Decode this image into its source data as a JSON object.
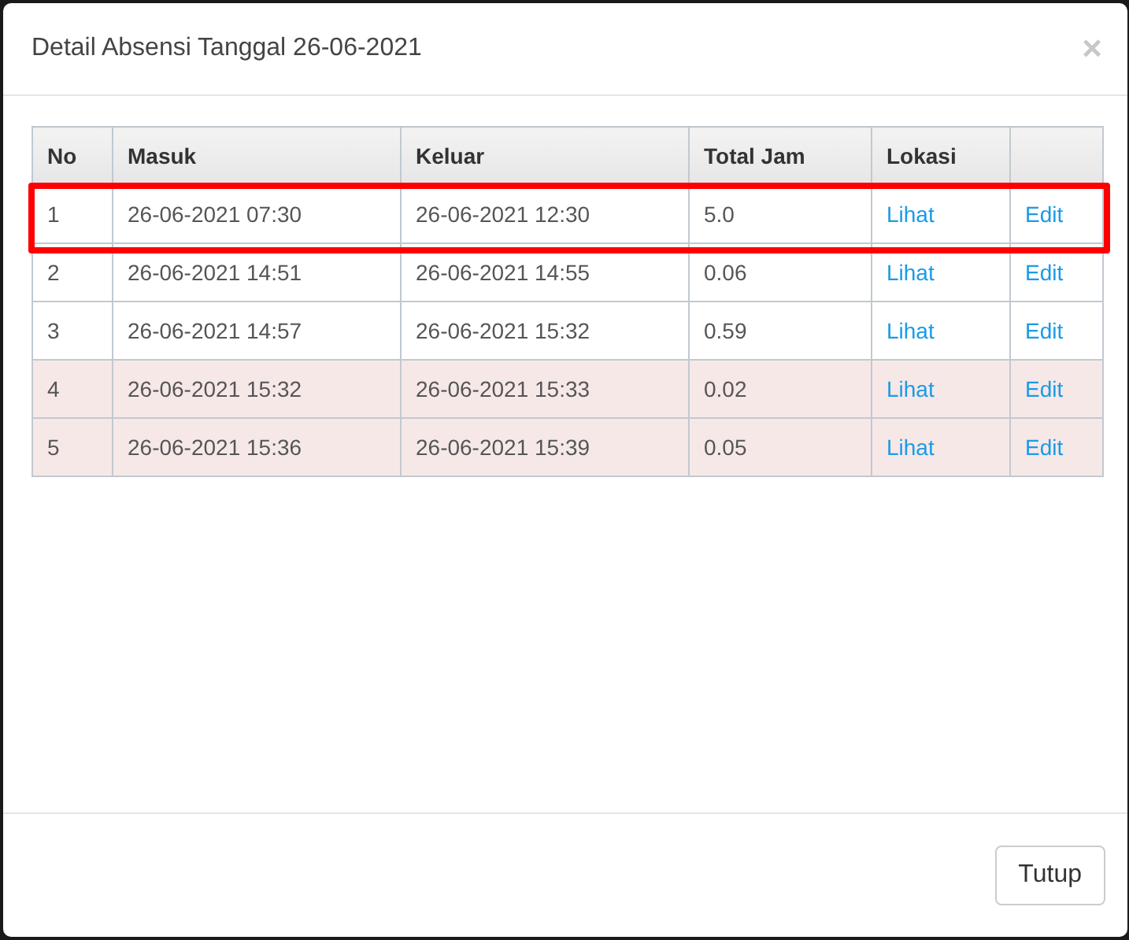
{
  "dialog": {
    "title": "Detail Absensi Tanggal 26-06-2021",
    "close": "×"
  },
  "table": {
    "columns": [
      "No",
      "Masuk",
      "Keluar",
      "Total Jam",
      "Lokasi"
    ],
    "rows": [
      {
        "no": "1",
        "masuk": "26-06-2021 07:30",
        "keluar": "26-06-2021 12:30",
        "total": "5.0",
        "lokasi": "Lihat",
        "edit": "Edit",
        "highlighted": false,
        "outlined": true
      },
      {
        "no": "2",
        "masuk": "26-06-2021 14:51",
        "keluar": "26-06-2021 14:55",
        "total": "0.06",
        "lokasi": "Lihat",
        "edit": "Edit",
        "highlighted": false,
        "outlined": false
      },
      {
        "no": "3",
        "masuk": "26-06-2021 14:57",
        "keluar": "26-06-2021 15:32",
        "total": "0.59",
        "lokasi": "Lihat",
        "edit": "Edit",
        "highlighted": false,
        "outlined": false
      },
      {
        "no": "4",
        "masuk": "26-06-2021 15:32",
        "keluar": "26-06-2021 15:33",
        "total": "0.02",
        "lokasi": "Lihat",
        "edit": "Edit",
        "highlighted": true,
        "outlined": false
      },
      {
        "no": "5",
        "masuk": "26-06-2021 15:36",
        "keluar": "26-06-2021 15:39",
        "total": "0.05",
        "lokasi": "Lihat",
        "edit": "Edit",
        "highlighted": true,
        "outlined": false
      }
    ]
  },
  "footer": {
    "button": "Tutup"
  }
}
